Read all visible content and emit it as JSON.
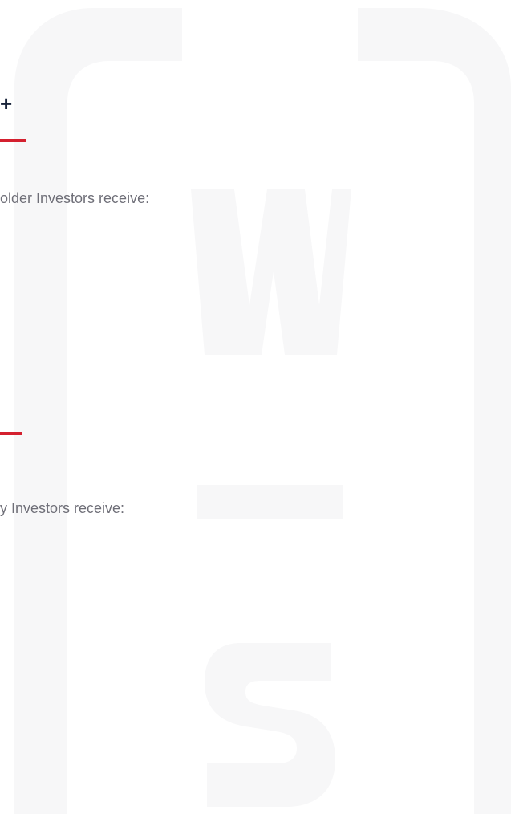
{
  "sections": [
    {
      "heading_fragment": "+",
      "intro": "older Investors receive:"
    },
    {
      "intro": "y Investors receive:"
    }
  ],
  "watermark": {
    "logo_name": "ws-monogram-logo",
    "color": "#f7f7f8"
  },
  "colors": {
    "accent": "#d4202f",
    "heading": "#18233a",
    "body_text": "#6f6f78",
    "background": "#ffffff"
  }
}
